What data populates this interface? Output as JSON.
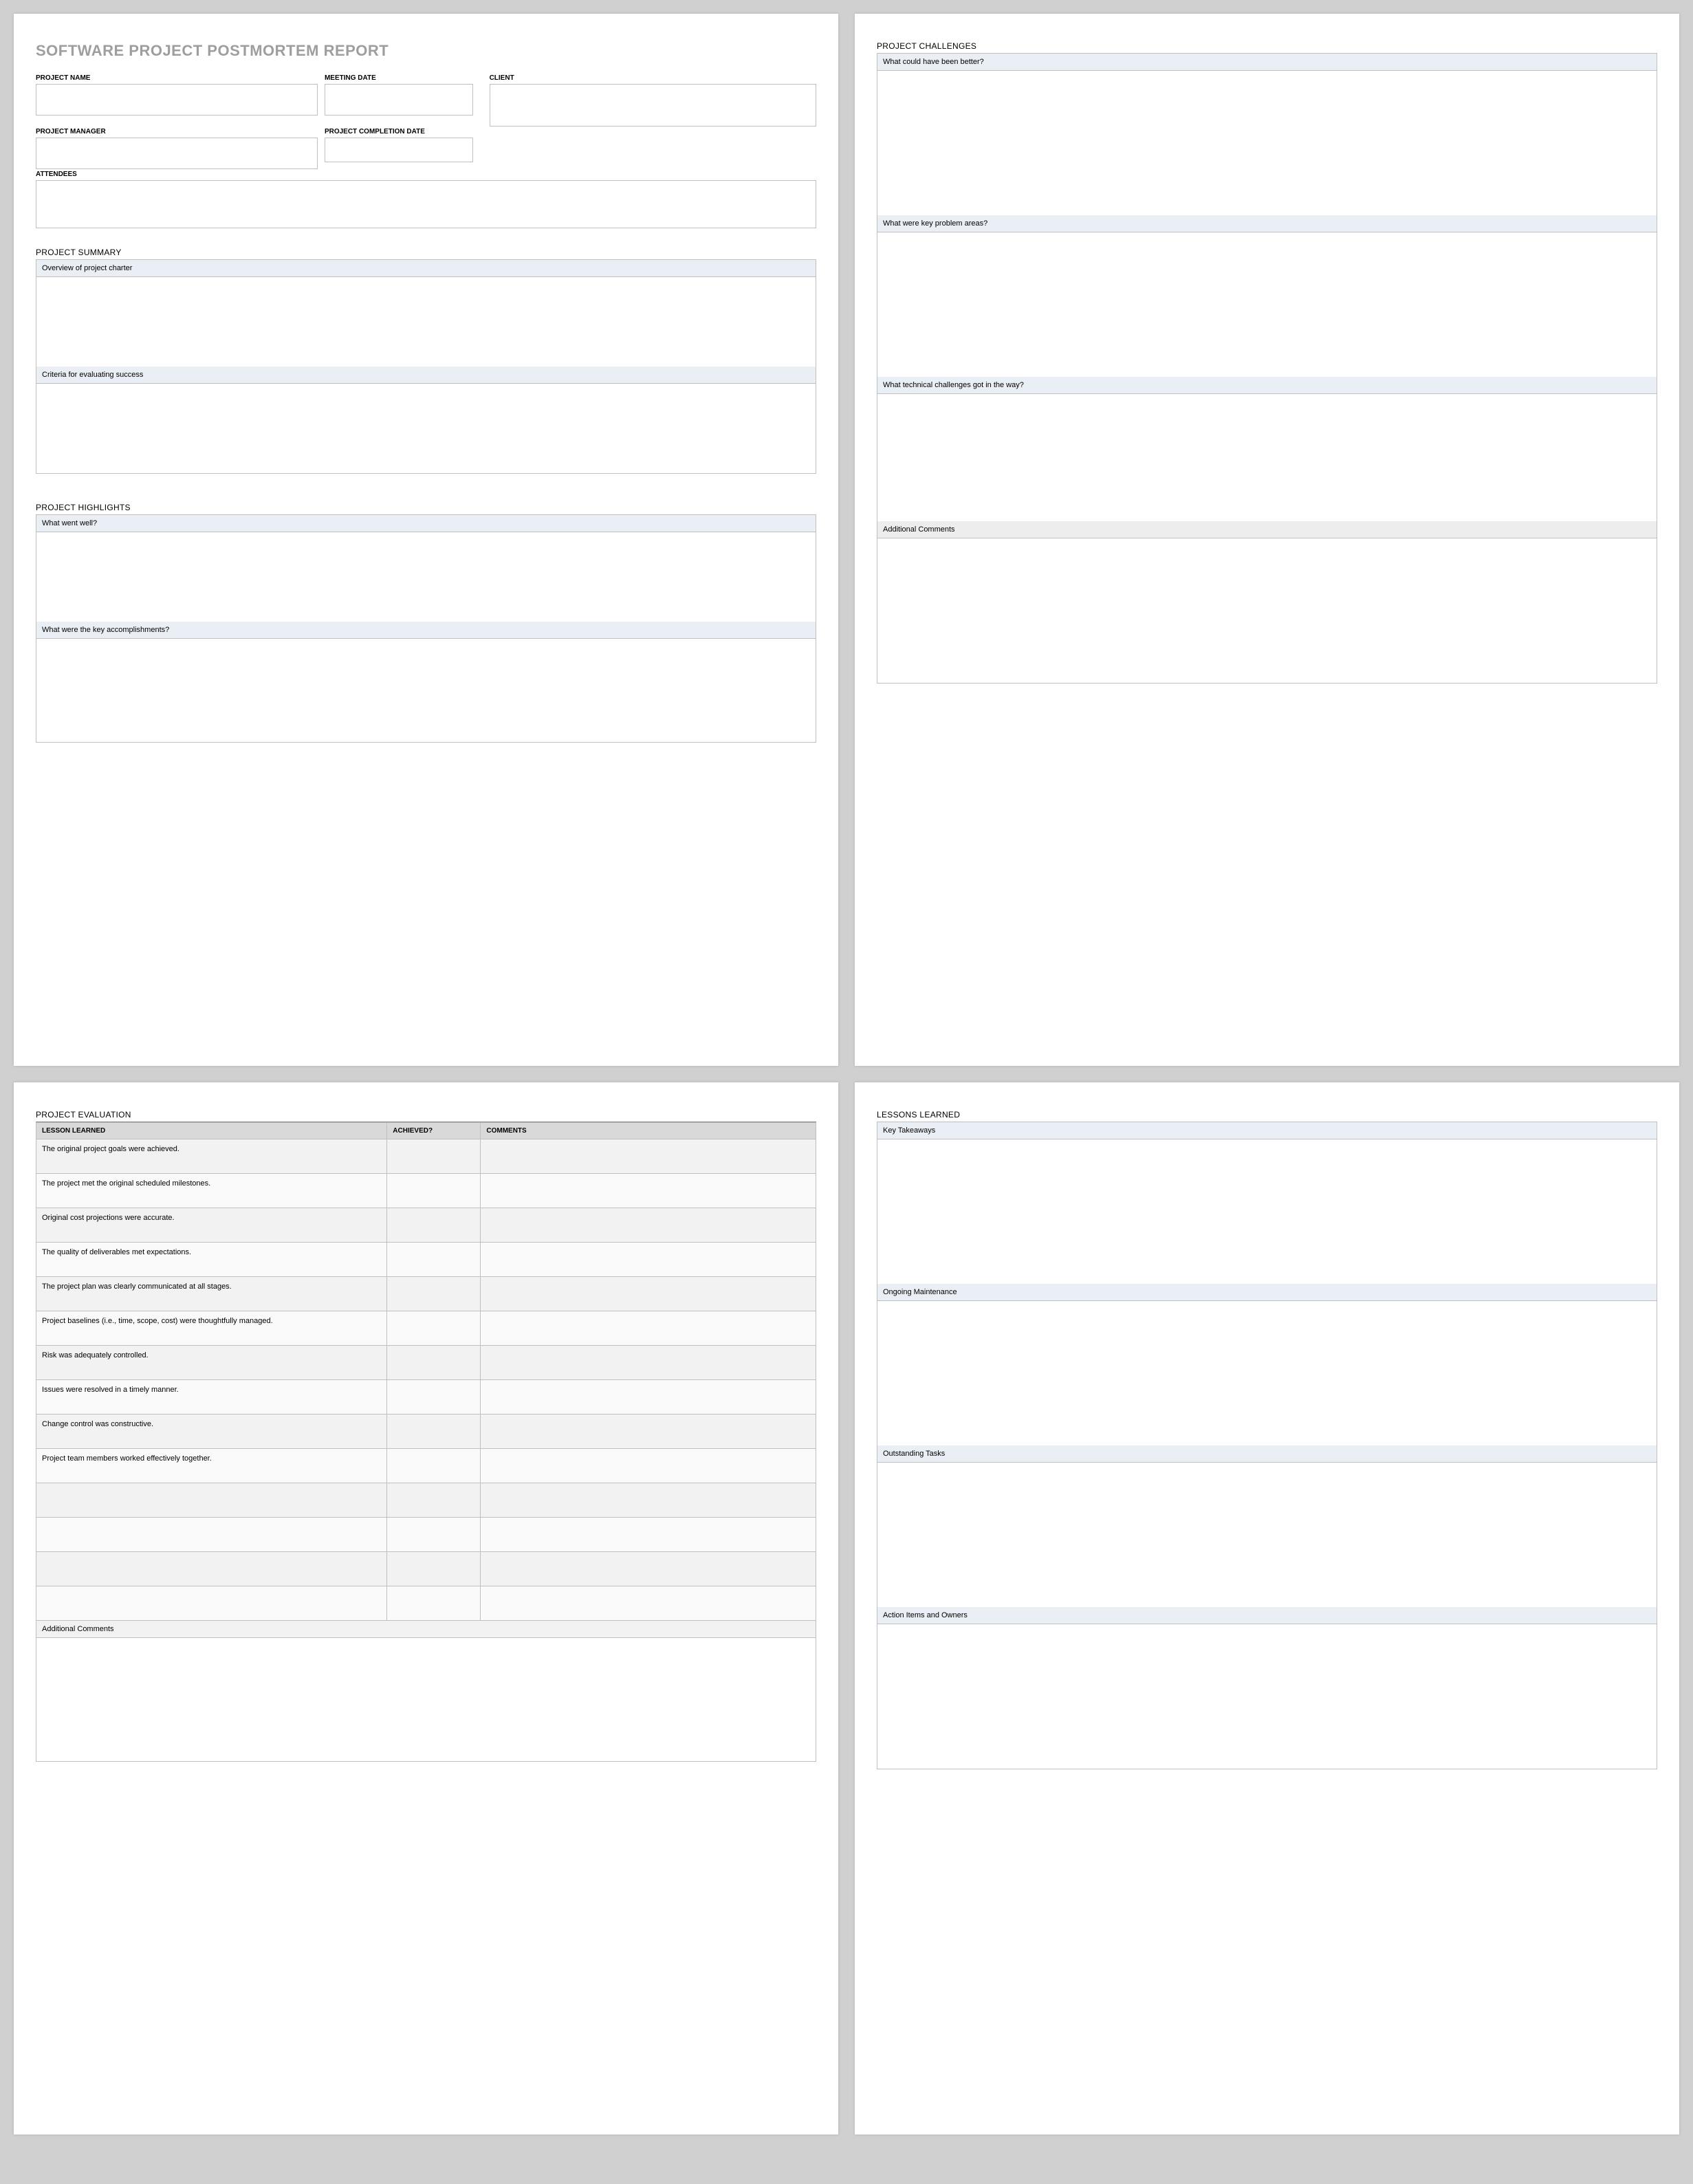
{
  "title": "SOFTWARE PROJECT POSTMORTEM REPORT",
  "meta": {
    "project_name_label": "PROJECT NAME",
    "meeting_date_label": "MEETING DATE",
    "client_label": "CLIENT",
    "project_manager_label": "PROJECT MANAGER",
    "completion_date_label": "PROJECT COMPLETION DATE",
    "attendees_label": "ATTENDEES"
  },
  "summary": {
    "heading": "PROJECT SUMMARY",
    "q1": "Overview of project charter",
    "q2": "Criteria for evaluating success"
  },
  "highlights": {
    "heading": "PROJECT HIGHLIGHTS",
    "q1": "What went well?",
    "q2": "What were the key accomplishments?"
  },
  "challenges": {
    "heading": "PROJECT CHALLENGES",
    "q1": "What could have been better?",
    "q2": "What were key problem areas?",
    "q3": "What technical challenges got in the way?",
    "q4": "Additional Comments"
  },
  "evaluation": {
    "heading": "PROJECT EVALUATION",
    "col_lesson": "LESSON LEARNED",
    "col_achieved": "ACHIEVED?",
    "col_comments": "COMMENTS",
    "rows": [
      "The original project goals were achieved.",
      "The project met the original scheduled milestones.",
      "Original cost projections were accurate.",
      "The quality of deliverables met expectations.",
      "The project plan was clearly communicated at all stages.",
      "Project baselines (i.e., time, scope, cost) were thoughtfully managed.",
      "Risk was adequately controlled.",
      "Issues were resolved in a timely manner.",
      "Change control was constructive.",
      "Project team members worked effectively together.",
      "",
      "",
      "",
      ""
    ],
    "additional_label": "Additional Comments"
  },
  "lessons": {
    "heading": "LESSONS LEARNED",
    "q1": "Key Takeaways",
    "q2": "Ongoing Maintenance",
    "q3": "Outstanding Tasks",
    "q4": "Action Items and Owners"
  }
}
